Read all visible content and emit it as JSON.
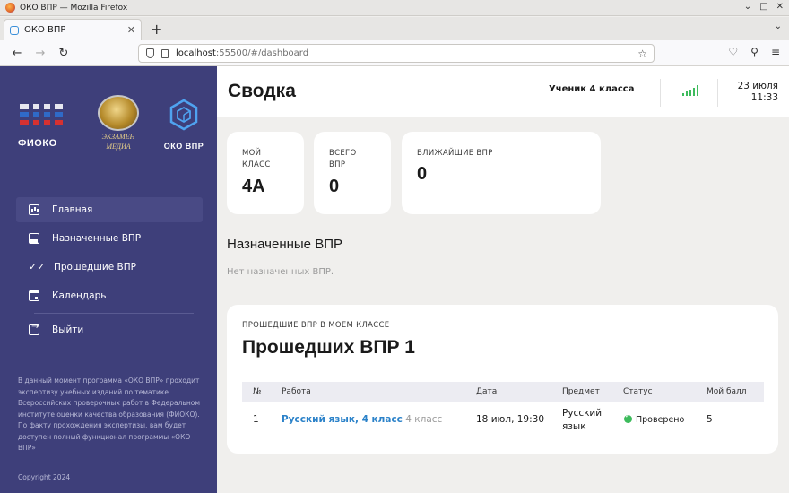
{
  "browser": {
    "window_title": "ОКО ВПР — Mozilla Firefox",
    "tab_title": "ОКО ВПР",
    "url_host": "localhost",
    "url_rest": ":55500/#/dashboard"
  },
  "sidebar": {
    "logos": {
      "fioko": "ФИОКО",
      "exam_line1": "ЭКЗАМЕН",
      "exam_line2": "МЕДИА",
      "oko": "ОКО ВПР"
    },
    "menu": [
      {
        "label": "Главная",
        "icon": "chart-icon",
        "active": true
      },
      {
        "label": "Назначенные ВПР",
        "icon": "inbox-icon"
      },
      {
        "label": "Прошедшие ВПР",
        "icon": "double-check-icon"
      },
      {
        "label": "Календарь",
        "icon": "calendar-icon"
      }
    ],
    "logout": "Выйти",
    "info": "В данный момент программа «ОКО ВПР» проходит экспертизу учебных изданий по тематике Всероссийских проверочных работ в Федеральном институте оценки качества образования (ФИОКО). По факту прохождения экспертизы, вам будет доступен полный функционал программы «ОКО ВПР»",
    "copyright": "Copyright 2024"
  },
  "header": {
    "title": "Сводка",
    "user": "Ученик 4 класса",
    "date": "23 июля",
    "time": "11:33"
  },
  "stats": [
    {
      "label1": "МОЙ",
      "label2": "КЛАСС",
      "value": "4А"
    },
    {
      "label1": "ВСЕГО",
      "label2": "ВПР",
      "value": "0"
    },
    {
      "label1": "БЛИЖАЙШИЕ ВПР",
      "label2": "",
      "value": "0"
    }
  ],
  "assigned": {
    "title": "Назначенные ВПР",
    "empty": "Нет назначенных ВПР."
  },
  "past": {
    "eyebrow": "ПРОШЕДШИЕ ВПР В МОЕМ КЛАССЕ",
    "title": "Прошедших ВПР 1",
    "columns": [
      "№",
      "Работа",
      "Дата",
      "Предмет",
      "Статус",
      "Мой балл"
    ],
    "rows": [
      {
        "num": "1",
        "work": "Русский язык, 4 класс",
        "grade": "4 класс",
        "date": "18 июл, 19:30",
        "subject_line1": "Русский",
        "subject_line2": "язык",
        "status": "Проверено",
        "score": "5"
      }
    ]
  },
  "colors": {
    "sidebar_bg": "#3e3f7a",
    "link": "#2b82c9",
    "success": "#3dbb5c"
  }
}
